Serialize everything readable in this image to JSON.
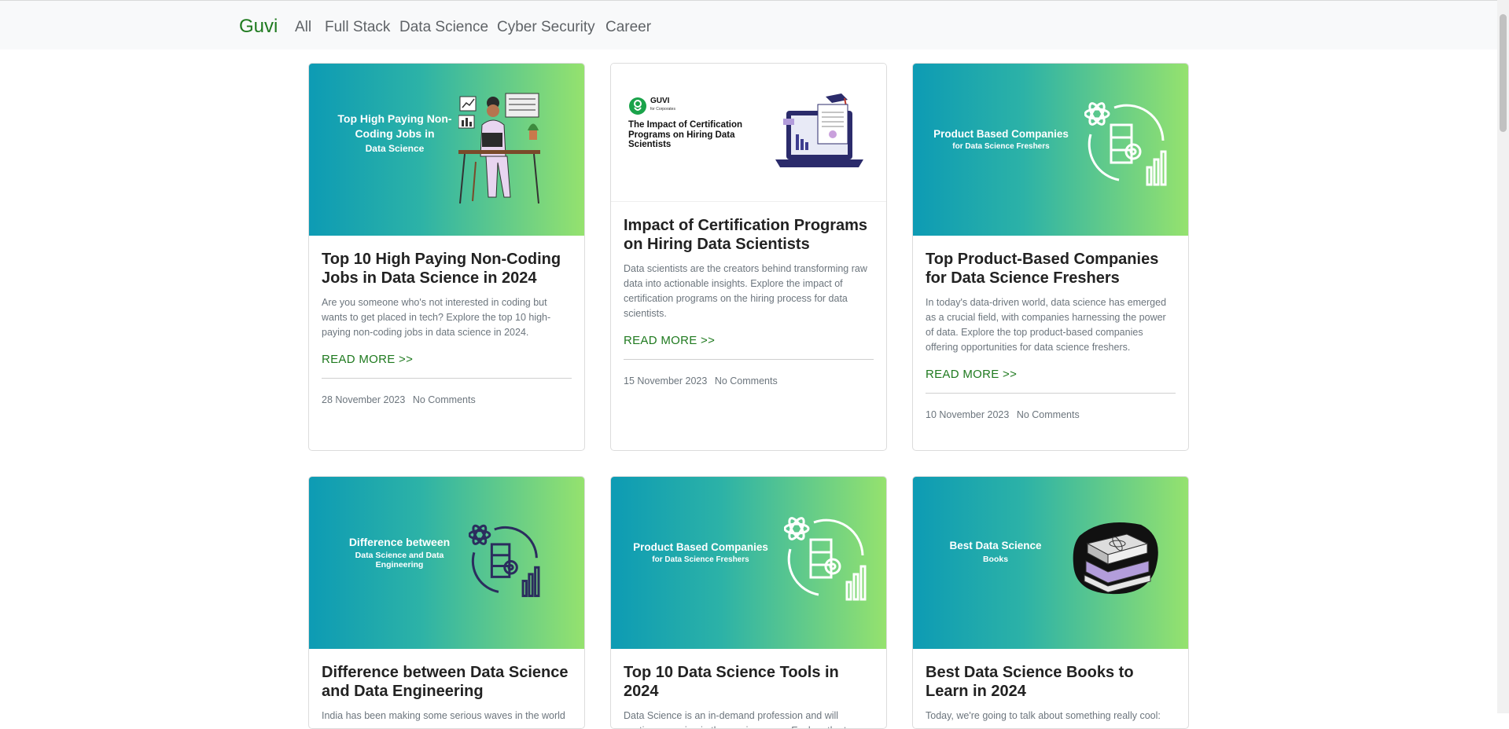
{
  "nav": {
    "brand": "Guvi",
    "links": [
      "All",
      "Full Stack",
      "Data Science",
      "Cyber Security",
      "Career"
    ]
  },
  "colors": {
    "brand": "#1f7a1f",
    "gradient_start": "#0d9bb4",
    "gradient_end": "#95e26e"
  },
  "cards": [
    {
      "image_text": [
        "Top High Paying Non-",
        "Coding Jobs in",
        "Data Science"
      ],
      "image_icon": "woman-at-desk-illustration",
      "title": "Top 10 High Paying Non-Coding Jobs in Data Science in 2024",
      "excerpt": "Are you someone who's not interested in coding but wants to get placed in tech? Explore the top 10 high-paying non-coding jobs in data science in 2024.",
      "read_more": "READ MORE >>",
      "date": "28 November 2023",
      "comments": "No Comments"
    },
    {
      "image_text": [
        "GUVI",
        "for Corporates",
        "The Impact of Certification Programs on Hiring Data Scientists"
      ],
      "image_icon": "laptop-certificate-illustration",
      "title": "Impact of Certification Programs on Hiring Data Scientists",
      "excerpt": "Data scientists are the creators behind transforming raw data into actionable insights. Explore the impact of certification programs on the hiring process for data scientists.",
      "read_more": "READ MORE >>",
      "date": "15 November 2023",
      "comments": "No Comments"
    },
    {
      "image_text": [
        "Product Based Companies",
        "for Data Science Freshers"
      ],
      "image_icon": "atom-server-chart-icon",
      "title": "Top Product-Based Companies for Data Science Freshers",
      "excerpt": "In today's data-driven world, data science has emerged as a crucial field, with companies harnessing the power of data. Explore the top product-based companies offering opportunities for data science freshers.",
      "read_more": "READ MORE >>",
      "date": "10 November 2023",
      "comments": "No Comments"
    },
    {
      "image_text": [
        "Difference between",
        "Data Science and Data",
        "Engineering"
      ],
      "image_icon": "atom-server-chart-icon",
      "title": "Difference between Data Science and Data Engineering",
      "excerpt": "India has been making some serious waves in the world"
    },
    {
      "image_text": [
        "Product Based Companies",
        "for Data Science Freshers"
      ],
      "image_icon": "atom-server-chart-icon",
      "title": "Top 10 Data Science Tools in 2024",
      "excerpt": "Data Science is an in-demand profession and will continue growing in the coming years. Explore the top"
    },
    {
      "image_text": [
        "Best Data Science",
        "Books"
      ],
      "image_icon": "book-stack-icon",
      "title": "Best Data Science Books to Learn in 2024",
      "excerpt": "Today, we're going to talk about something really cool:"
    }
  ]
}
